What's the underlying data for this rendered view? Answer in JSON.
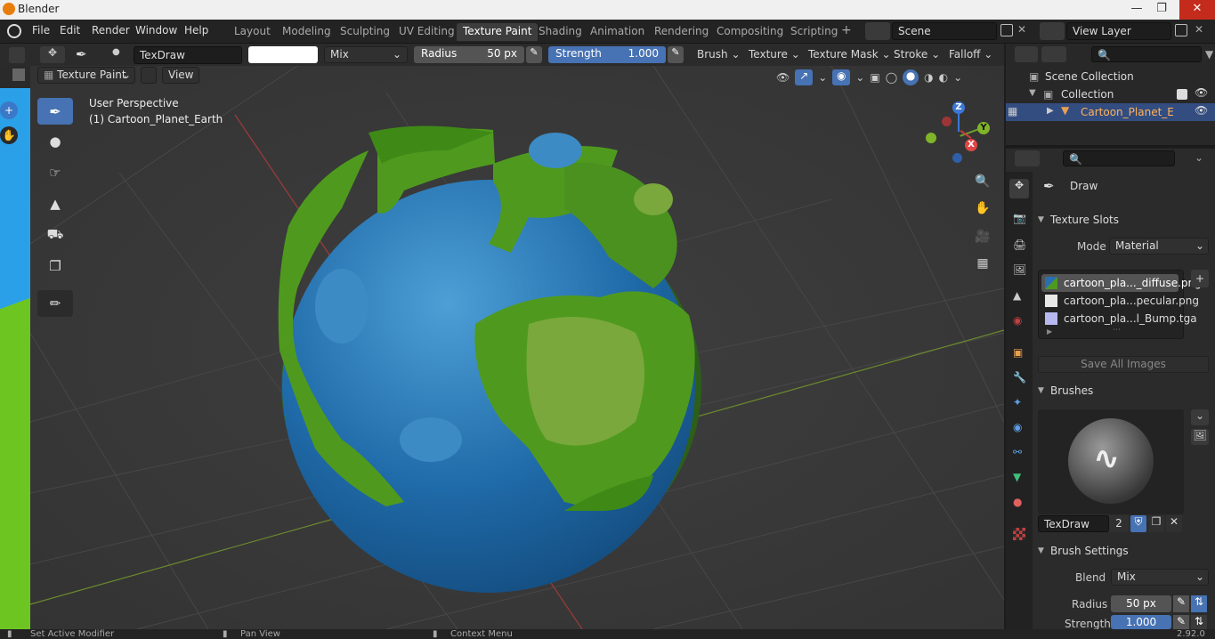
{
  "window": {
    "title": "Blender"
  },
  "menu": [
    "File",
    "Edit",
    "Render",
    "Window",
    "Help"
  ],
  "workspaces": [
    "Layout",
    "Modeling",
    "Sculpting",
    "UV Editing",
    "Texture Paint",
    "Shading",
    "Animation",
    "Rendering",
    "Compositing",
    "Scripting"
  ],
  "active_workspace": "Texture Paint",
  "scene": "Scene",
  "view_layer": "View Layer",
  "tool_header": {
    "brush_name": "TexDraw",
    "blend": "Mix",
    "radius_label": "Radius",
    "radius_value": "50 px",
    "strength_label": "Strength",
    "strength_value": "1.000",
    "brush_menu": "Brush",
    "texture_menu": "Texture",
    "texture_mask_menu": "Texture Mask",
    "stroke_menu": "Stroke",
    "falloff_menu": "Falloff"
  },
  "viewport_header": {
    "mode": "Texture Paint",
    "view": "View"
  },
  "viewport": {
    "perspective": "User Perspective",
    "object_label": "(1) Cartoon_Planet_Earth"
  },
  "gizmo": {
    "x": "X",
    "y": "Y",
    "z": "Z"
  },
  "outliner": {
    "scene_collection": "Scene Collection",
    "collection": "Collection",
    "object": "Cartoon_Planet_Earth"
  },
  "properties": {
    "tool_name": "Draw",
    "texture_slots_title": "Texture Slots",
    "mode_label": "Mode",
    "mode_value": "Material",
    "slots": [
      "cartoon_pla..._diffuse.png",
      "cartoon_pla...pecular.png",
      "cartoon_pla...l_Bump.tga"
    ],
    "save_all_images": "Save All Images",
    "brushes_title": "Brushes",
    "brush_name": "TexDraw",
    "brush_users": "2",
    "brush_settings_title": "Brush Settings",
    "blend_label": "Blend",
    "blend_value": "Mix",
    "radius_label": "Radius",
    "radius_value": "50 px",
    "strength_label": "Strength",
    "strength_value": "1.000"
  },
  "statusbar": {
    "left": "Set Active Modifier",
    "mid": "Pan View",
    "right": "Context Menu",
    "version": "2.92.0"
  },
  "colors": {
    "accent": "#4772b3",
    "ocean": "#2a6fad",
    "land": "#4f9a1e"
  }
}
